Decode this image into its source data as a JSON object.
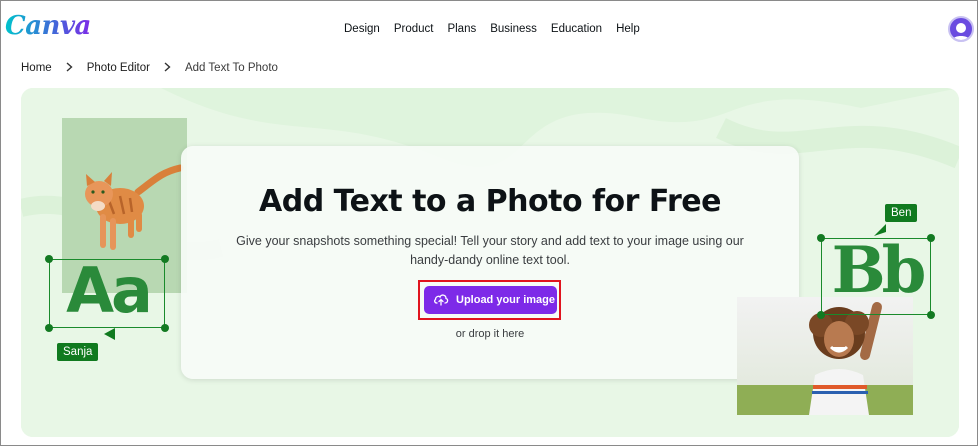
{
  "header": {
    "logo": "Canva",
    "nav": [
      "Design",
      "Product",
      "Plans",
      "Business",
      "Education",
      "Help"
    ]
  },
  "breadcrumb": {
    "items": [
      "Home",
      "Photo Editor"
    ],
    "current": "Add Text To Photo"
  },
  "hero": {
    "title": "Add Text to a Photo for Free",
    "description": "Give your snapshots something special! Tell your story and add text to your image using our handy-dandy online text tool.",
    "upload_label": "Upload your image",
    "drop_text": "or drop it here",
    "left_sample": {
      "glyphs": "Aa",
      "tag": "Sanja"
    },
    "right_sample": {
      "glyphs": "Bb",
      "tag": "Ben"
    }
  },
  "colors": {
    "accent": "#7d2ae8",
    "hero_bg": "#dff4dd",
    "tag_green": "#107a1f",
    "highlight": "#e0141e"
  },
  "icons": [
    "user-avatar-icon",
    "chevron-right-icon",
    "upload-cloud-icon"
  ]
}
